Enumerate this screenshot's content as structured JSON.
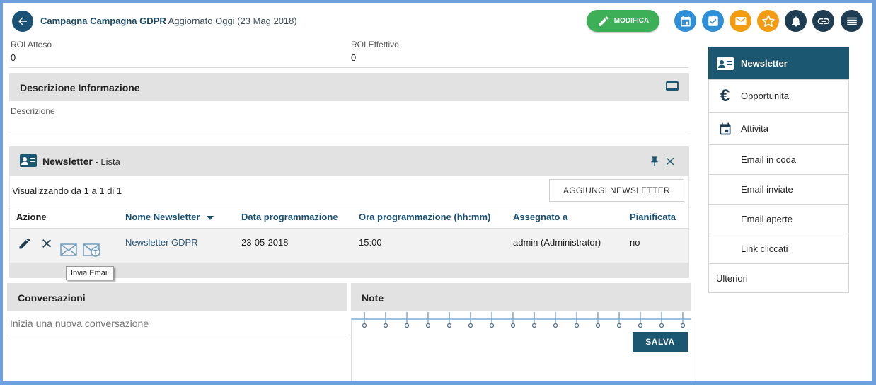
{
  "header": {
    "title": "Campagna Campagna GDPR",
    "updated": "Aggiornato Oggi (23 Mag 2018)",
    "edit_label": "MODIFICA"
  },
  "fields": {
    "roi_atteso_label": "ROI Atteso",
    "roi_atteso_value": "0",
    "roi_effettivo_label": "ROI Effettivo",
    "roi_effettivo_value": "0"
  },
  "descrizione_panel": {
    "title": "Descrizione Informazione",
    "field_label": "Descrizione"
  },
  "newsletter_panel": {
    "title": "Newsletter",
    "subtitle": "- Lista",
    "showing": "Visualizzando da 1 a 1 di 1",
    "add_button": "AGGIUNGI NEWSLETTER",
    "columns": [
      "Azione",
      "Nome Newsletter",
      "Data programmazione",
      "Ora programmazione (hh:mm)",
      "Assegnato a",
      "Pianificata"
    ],
    "rows": [
      {
        "name": "Newsletter GDPR",
        "date": "23-05-2018",
        "time": "15:00",
        "assigned": "admin (Administrator)",
        "scheduled": "no"
      }
    ],
    "tooltip": "Invia Email"
  },
  "conversazioni": {
    "title": "Conversazioni",
    "placeholder": "Inizia una nuova conversazione"
  },
  "note": {
    "title": "Note",
    "save_label": "SALVA"
  },
  "sidebar": {
    "items": [
      {
        "label": "Newsletter",
        "active": true
      },
      {
        "label": "Opportunita",
        "active": false
      },
      {
        "label": "Attivita",
        "active": false
      },
      {
        "label": "Email in coda",
        "active": false
      },
      {
        "label": "Email inviate",
        "active": false
      },
      {
        "label": "Email aperte",
        "active": false
      },
      {
        "label": "Link cliccati",
        "active": false
      },
      {
        "label": "Ulteriori",
        "active": false
      }
    ]
  },
  "colors": {
    "primary": "#1b5770",
    "success": "#3daf57",
    "icon_blue": "#2e8fd6",
    "icon_orange": "#f39c12",
    "icon_dark": "#1e3d52"
  }
}
